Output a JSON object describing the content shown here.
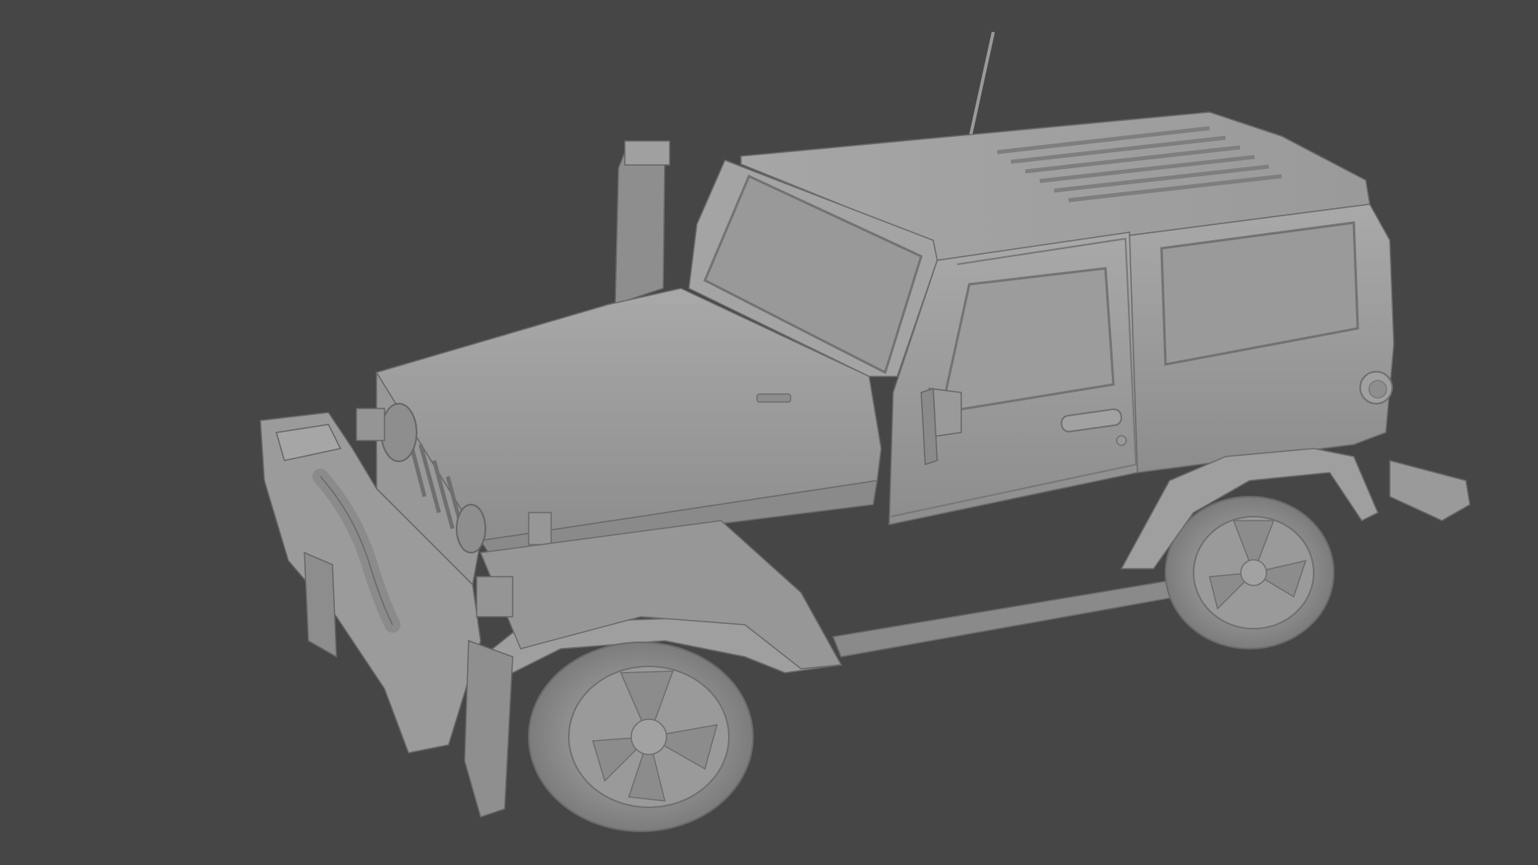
{
  "scene": {
    "type": "3d-viewport-render",
    "subject": "jeep",
    "shading": "solid-clay",
    "colors": {
      "background": "#464646",
      "body_light": "#a3a3a3",
      "body_mid": "#8f8f8f",
      "body_dark": "#6f6f6f",
      "line": "#666666"
    }
  }
}
